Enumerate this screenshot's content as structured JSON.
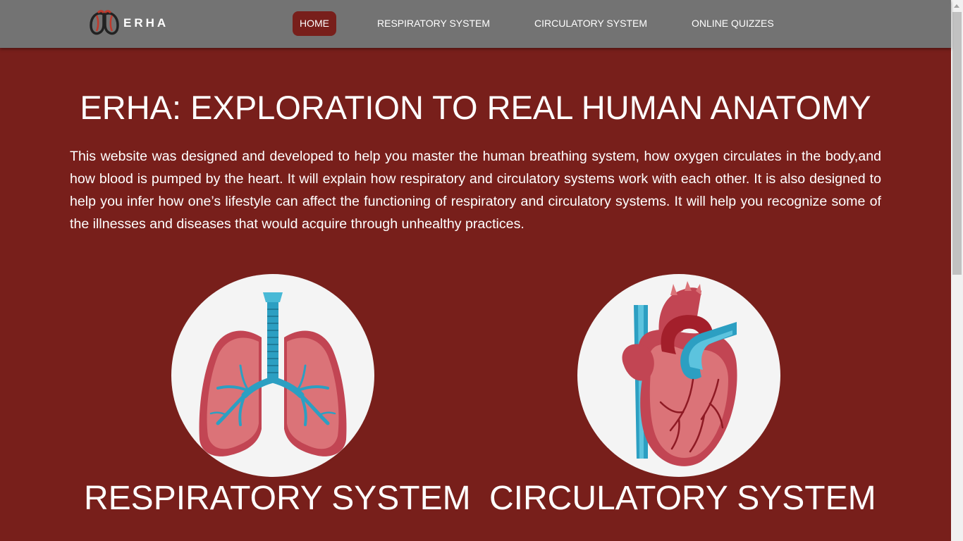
{
  "brand": {
    "name": "ERHA",
    "logo_icon": "lungs-logo-icon"
  },
  "nav": {
    "items": [
      {
        "label": "HOME",
        "active": true
      },
      {
        "label": "RESPIRATORY SYSTEM",
        "active": false
      },
      {
        "label": "CIRCULATORY SYSTEM",
        "active": false
      },
      {
        "label": "ONLINE QUIZZES",
        "active": false
      }
    ]
  },
  "hero": {
    "title": "ERHA: EXPLORATION TO REAL HUMAN ANATOMY",
    "intro": "This website was designed and developed to help you master the human breathing system, how oxygen circulates in the body,and how blood is pumped by the heart. It will explain how respiratory and circulatory systems work with each other. It is also designed to help you infer how one’s lifestyle can affect the functioning of respiratory and circulatory systems. It will help you recognize some of the illnesses and diseases that would acquire through unhealthy practices."
  },
  "sections": [
    {
      "title": "RESPIRATORY SYSTEM",
      "icon": "lungs-illustration"
    },
    {
      "title": "CIRCULATORY SYSTEM",
      "icon": "heart-illustration"
    }
  ],
  "colors": {
    "background": "#781f1b",
    "navbar": "#737373",
    "active_nav": "#781f1b",
    "text": "#ffffff",
    "circle": "#f4f4f4"
  }
}
